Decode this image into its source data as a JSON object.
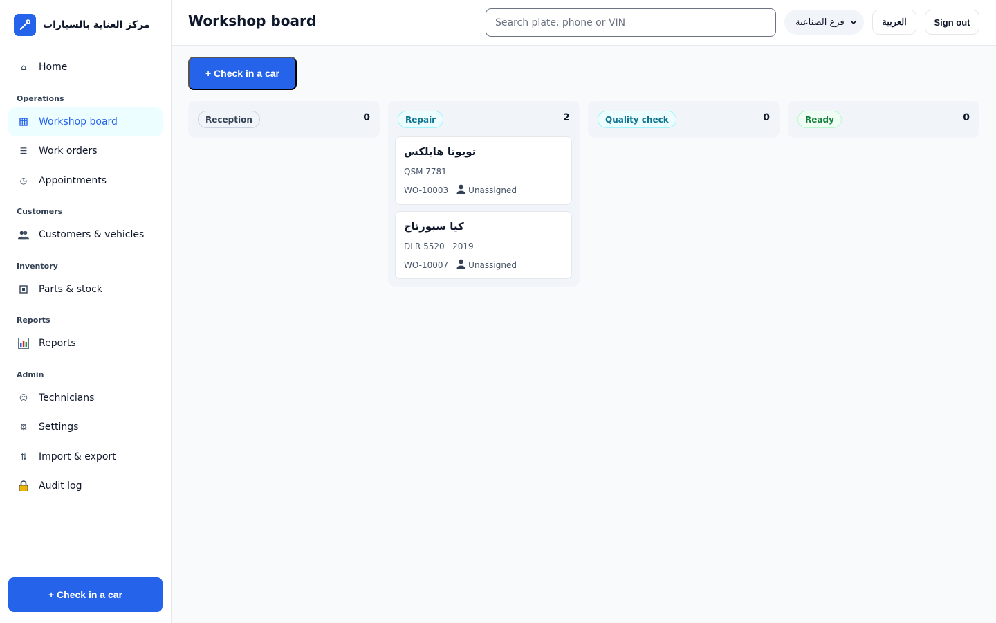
{
  "brand": {
    "name": "مركز العناية بالسيارات",
    "logo_icon": "wrench-icon",
    "accent": "#2563eb"
  },
  "sidebar": {
    "home": {
      "label": "Home",
      "icon": "home-icon"
    },
    "sections": {
      "operations": "Operations",
      "customers": "Customers",
      "inventory": "Inventory",
      "reports": "Reports",
      "admin": "Admin"
    },
    "items": {
      "workshop_board": {
        "label": "Workshop board",
        "icon": "grid-icon",
        "active": true
      },
      "work_orders": {
        "label": "Work orders",
        "icon": "list-icon"
      },
      "appointments": {
        "label": "Appointments",
        "icon": "clock-icon"
      },
      "customers_vehicles": {
        "label": "Customers & vehicles",
        "icon": "people-icon"
      },
      "parts_stock": {
        "label": "Parts & stock",
        "icon": "box-icon"
      },
      "reports": {
        "label": "Reports",
        "icon": "bar-chart-icon"
      },
      "technicians": {
        "label": "Technicians",
        "icon": "smiley-icon"
      },
      "settings": {
        "label": "Settings",
        "icon": "gear-icon"
      },
      "import_export": {
        "label": "Import & export",
        "icon": "arrows-updown-icon"
      },
      "audit_log": {
        "label": "Audit log",
        "icon": "lock-icon"
      }
    },
    "cta": "+ Check in a car"
  },
  "header": {
    "title": "Workshop board",
    "search_placeholder": "Search plate, phone or VIN",
    "branch": "فرع الصناعية",
    "language_button": "العربية",
    "signout_button": "Sign out"
  },
  "main": {
    "cta": "+ Check in a car"
  },
  "board": {
    "columns": [
      {
        "name": "Reception",
        "count": "0",
        "pill_bg": "#f1f5f9",
        "pill_border": "#cbd5e1",
        "pill_color": "#334155"
      },
      {
        "name": "Repair",
        "count": "2",
        "pill_bg": "#ecfeff",
        "pill_border": "#a5f3fc",
        "pill_color": "#0e7490"
      },
      {
        "name": "Quality check",
        "count": "0",
        "pill_bg": "#ecfeff",
        "pill_border": "#a5f3fc",
        "pill_color": "#0e7490"
      },
      {
        "name": "Ready",
        "count": "0",
        "pill_bg": "#f0fdf4",
        "pill_border": "#bbf7d0",
        "pill_color": "#15803d"
      }
    ],
    "repair_cards": [
      {
        "vehicle": "تويوتا هايلكس",
        "plate": "QSM 7781",
        "work_order": "WO-10003",
        "technician": "Unassigned"
      },
      {
        "vehicle": "كيا سبورتاج",
        "plate": "DLR 5520   2019",
        "work_order": "WO-10007",
        "technician": "Unassigned"
      }
    ]
  }
}
